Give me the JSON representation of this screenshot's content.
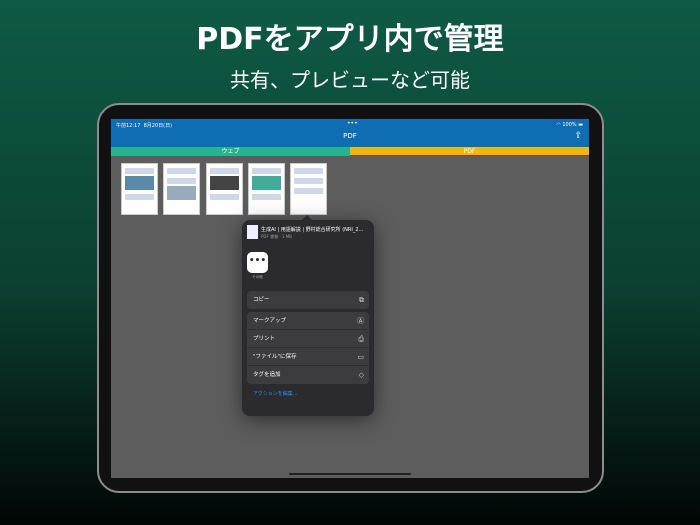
{
  "headline": "PDFをアプリ内で管理",
  "subheadline": "共有、プレビューなど可能",
  "status": {
    "time": "午前12:17",
    "date": "8月20日(日)",
    "battery": "100%"
  },
  "nav": {
    "title": "PDF"
  },
  "tabs": [
    "ウェブ",
    "PDF"
  ],
  "sheet": {
    "file_name": "生成AI | 用語解説 | 野村総合研究所 (NRI_2...",
    "file_info": "PDF 書類 · 1 MB",
    "more_label": "その他",
    "actions": [
      {
        "label": "コピー",
        "icon": "copy-icon"
      }
    ],
    "actions2": [
      {
        "label": "マークアップ",
        "icon": "markup-icon"
      },
      {
        "label": "プリント",
        "icon": "print-icon"
      },
      {
        "label": "\"ファイル\"に保存",
        "icon": "folder-icon"
      },
      {
        "label": "タグを追加",
        "icon": "tag-icon"
      }
    ],
    "edit_actions": "アクションを編集..."
  }
}
